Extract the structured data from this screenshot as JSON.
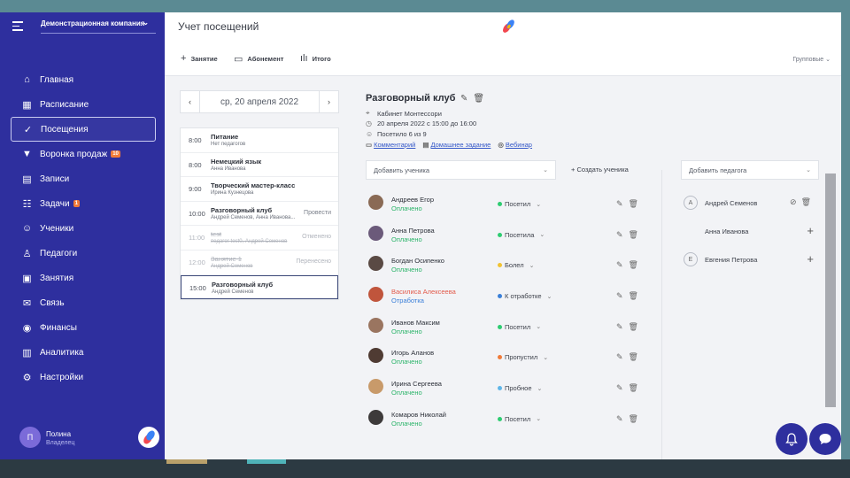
{
  "sidebar": {
    "company": "Демонстрационная компания",
    "items": [
      {
        "label": "Главная",
        "icon": "home-icon",
        "glyph": "⌂"
      },
      {
        "label": "Расписание",
        "icon": "calendar-icon",
        "glyph": "▦"
      },
      {
        "label": "Посещения",
        "icon": "check-icon",
        "glyph": "✓"
      },
      {
        "label": "Воронка продаж",
        "icon": "funnel-icon",
        "glyph": "▼",
        "badge": "10"
      },
      {
        "label": "Записи",
        "icon": "document-icon",
        "glyph": "▤"
      },
      {
        "label": "Задачи",
        "icon": "tasks-icon",
        "glyph": "☷",
        "badge": "1"
      },
      {
        "label": "Ученики",
        "icon": "user-icon",
        "glyph": "☺"
      },
      {
        "label": "Педагоги",
        "icon": "teacher-icon",
        "glyph": "♙"
      },
      {
        "label": "Занятия",
        "icon": "briefcase-icon",
        "glyph": "▣"
      },
      {
        "label": "Связь",
        "icon": "mail-icon",
        "glyph": "✉"
      },
      {
        "label": "Финансы",
        "icon": "finance-icon",
        "glyph": "◉"
      },
      {
        "label": "Аналитика",
        "icon": "chart-icon",
        "glyph": "▥"
      },
      {
        "label": "Настройки",
        "icon": "gear-icon",
        "glyph": "⚙"
      }
    ],
    "user": {
      "initial": "П",
      "name": "Полина",
      "role": "Владелец"
    }
  },
  "header": {
    "title": "Учет посещений",
    "toolbar": {
      "lesson": "Занятие",
      "subscription": "Абонемент",
      "total": "Итого"
    },
    "groups": "Групповые"
  },
  "calendar": {
    "date": "ср, 20 апреля 2022",
    "lessons": [
      {
        "time": "8:00",
        "name": "Питание",
        "sub": "Нет педагогов",
        "status": "",
        "state": "normal"
      },
      {
        "time": "8:00",
        "name": "Немецкий язык",
        "sub": "Анна Иванова",
        "status": "",
        "state": "normal"
      },
      {
        "time": "9:00",
        "name": "Творческий мастер-класс",
        "sub": "Ирина Кузнецова",
        "status": "",
        "state": "normal"
      },
      {
        "time": "10:00",
        "name": "Разговорный клуб",
        "sub": "Андрей Семенов, Анна Иванова...",
        "status": "Провести",
        "state": "normal"
      },
      {
        "time": "11:00",
        "name": "test",
        "sub": "педагог test0, Андрей Семенов",
        "status": "Отменено",
        "state": "cancelled"
      },
      {
        "time": "12:00",
        "name": "Занятие 1",
        "sub": "Андрей Семенов",
        "status": "Перенесено",
        "state": "cancelled"
      },
      {
        "time": "15:00",
        "name": "Разговорный клуб",
        "sub": "Андрей Семенов",
        "status": "",
        "state": "selected"
      }
    ]
  },
  "lesson": {
    "title": "Разговорный клуб",
    "room": "Кабинет Монтессори",
    "datetime": "20 апреля 2022 с 15:00 до 16:00",
    "visited": "Посетило 6 из 9",
    "comment": "Комментарий",
    "homework": "Домашнее задание",
    "webinar": "Вебинар",
    "add_student": "Добавить ученика",
    "create_student": "Создать ученика",
    "add_teacher": "Добавить педагога"
  },
  "students": [
    {
      "name": "Андреев Егор",
      "pay": "Оплачено",
      "status": "Посетил",
      "dot": "#2ecc71",
      "avatar": "#8a6a55",
      "name_color": "normal",
      "pay_color": "green"
    },
    {
      "name": "Анна Петрова",
      "pay": "Оплачено",
      "status": "Посетила",
      "dot": "#2ecc71",
      "avatar": "#6b5a7a",
      "name_color": "normal",
      "pay_color": "green"
    },
    {
      "name": "Богдан Осипенко",
      "pay": "Оплачено",
      "status": "Болел",
      "dot": "#f1c232",
      "avatar": "#5a4a44",
      "name_color": "normal",
      "pay_color": "green"
    },
    {
      "name": "Василиса Алексеева",
      "pay": "Отработка",
      "status": "К отработке",
      "dot": "#3a7fd8",
      "avatar": "#c0553c",
      "name_color": "red",
      "pay_color": "blue"
    },
    {
      "name": "Иванов Максим",
      "pay": "Оплачено",
      "status": "Посетил",
      "dot": "#2ecc71",
      "avatar": "#9a7560",
      "name_color": "normal",
      "pay_color": "green"
    },
    {
      "name": "Игорь Аланов",
      "pay": "Оплачено",
      "status": "Пропустил",
      "dot": "#f07b39",
      "avatar": "#4f3b33",
      "name_color": "normal",
      "pay_color": "green"
    },
    {
      "name": "Ирина Сергеева",
      "pay": "Оплачено",
      "status": "Пробное",
      "dot": "#5fb6e8",
      "avatar": "#c89a6a",
      "name_color": "normal",
      "pay_color": "green"
    },
    {
      "name": "Комаров Николай",
      "pay": "Оплачено",
      "status": "Посетил",
      "dot": "#2ecc71",
      "avatar": "#3d3a3a",
      "name_color": "normal",
      "pay_color": "green"
    }
  ],
  "teachers": [
    {
      "initial": "A",
      "name": "Андрей Семенов",
      "action": "assigned"
    },
    {
      "initial": "",
      "name": "Анна Иванова",
      "action": "add"
    },
    {
      "initial": "E",
      "name": "Евгения Петрова",
      "action": "add"
    }
  ],
  "colors": {
    "sidebar": "#2e2f9e",
    "accent": "#3558c8",
    "paid": "#2cb46a"
  }
}
